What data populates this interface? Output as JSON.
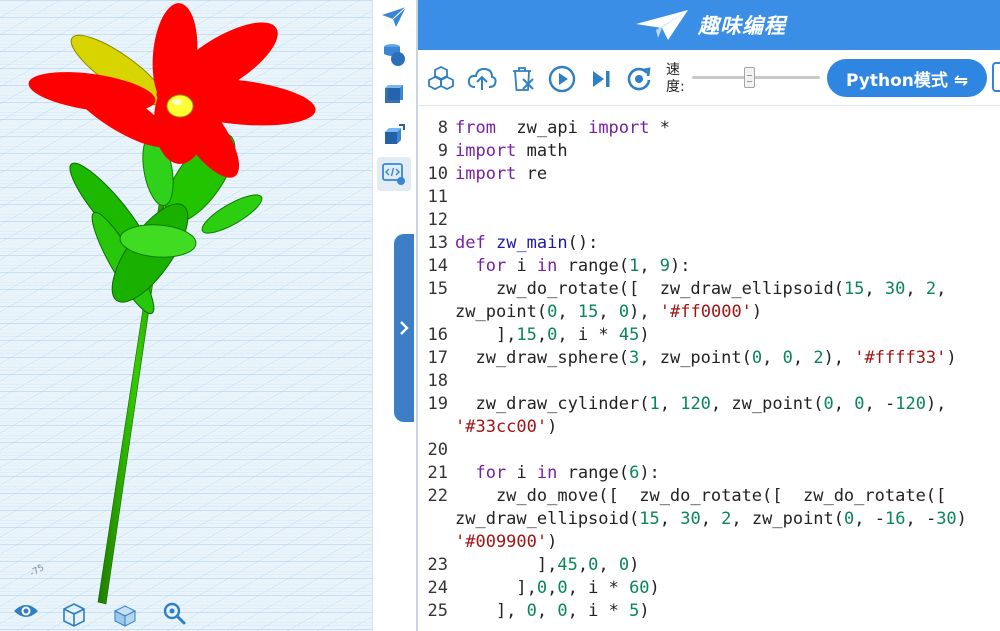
{
  "viewport": {
    "axis_tick": "-75",
    "colors": {
      "background": "#eaf4fb",
      "grid": "#a8cde8",
      "petal": "#ff0000",
      "center": "#ffff33",
      "stem": "#33cc00",
      "leaf": "#009900"
    },
    "bottom_controls": [
      {
        "icon": "eye-icon",
        "name": "view-visibility-button"
      },
      {
        "icon": "wireframe-cube-icon",
        "name": "view-wireframe-button"
      },
      {
        "icon": "solid-cube-icon",
        "name": "view-solid-button"
      },
      {
        "icon": "zoom-icon",
        "name": "view-zoom-button"
      }
    ]
  },
  "toolbox": {
    "items": [
      {
        "icon": "paper-plane-icon"
      },
      {
        "icon": "shapes-icon"
      },
      {
        "icon": "cube-icon"
      },
      {
        "icon": "transform-cube-icon"
      },
      {
        "icon": "code-icon",
        "active": true
      }
    ]
  },
  "header": {
    "title": "趣味编程",
    "logo": "paper-plane-logo"
  },
  "controls": {
    "buttons": [
      {
        "icon": "blocks-icon"
      },
      {
        "icon": "cloud-upload-icon"
      },
      {
        "icon": "clear-trash-icon"
      },
      {
        "icon": "run-icon"
      },
      {
        "icon": "step-icon"
      },
      {
        "icon": "reset-icon"
      }
    ],
    "speed_label": "速度:",
    "speed_value": 0.45,
    "mode_label": "Python模式 ⇋"
  },
  "code": {
    "lines": [
      {
        "n": "8",
        "t": [
          [
            "kw",
            "from"
          ],
          [
            "",
            "  zw_api "
          ],
          [
            "kw",
            "import"
          ],
          [
            "",
            " *"
          ]
        ]
      },
      {
        "n": "9",
        "t": [
          [
            "kw",
            "import"
          ],
          [
            "",
            " math"
          ]
        ]
      },
      {
        "n": "10",
        "t": [
          [
            "kw",
            "import"
          ],
          [
            "",
            " re"
          ]
        ]
      },
      {
        "n": "11",
        "t": []
      },
      {
        "n": "12",
        "t": []
      },
      {
        "n": "13",
        "t": [
          [
            "kw",
            "def"
          ],
          [
            "",
            " "
          ],
          [
            "fn",
            "zw_main"
          ],
          [
            "",
            "():"
          ]
        ]
      },
      {
        "n": "14",
        "t": [
          [
            "",
            "  "
          ],
          [
            "kw",
            "for"
          ],
          [
            "",
            " i "
          ],
          [
            "kw",
            "in"
          ],
          [
            "",
            " range("
          ],
          [
            "nm",
            "1"
          ],
          [
            "",
            ", "
          ],
          [
            "nm",
            "9"
          ],
          [
            "",
            "):"
          ]
        ]
      },
      {
        "n": "15",
        "t": [
          [
            "",
            "    zw_do_rotate([  zw_draw_ellipsoid("
          ],
          [
            "nm",
            "15"
          ],
          [
            "",
            ", "
          ],
          [
            "nm",
            "30"
          ],
          [
            "",
            ", "
          ],
          [
            "nm",
            "2"
          ],
          [
            "",
            ","
          ]
        ]
      },
      {
        "n": "",
        "t": [
          [
            "",
            "zw_point("
          ],
          [
            "nm",
            "0"
          ],
          [
            "",
            ", "
          ],
          [
            "nm",
            "15"
          ],
          [
            "",
            ", "
          ],
          [
            "nm",
            "0"
          ],
          [
            "",
            "), "
          ],
          [
            "st",
            "'#ff0000'"
          ],
          [
            "",
            ")"
          ]
        ]
      },
      {
        "n": "16",
        "t": [
          [
            "",
            "    ],"
          ],
          [
            "nm",
            "15"
          ],
          [
            "",
            ","
          ],
          [
            "nm",
            "0"
          ],
          [
            "",
            ", i * "
          ],
          [
            "nm",
            "45"
          ],
          [
            "",
            ")"
          ]
        ]
      },
      {
        "n": "17",
        "t": [
          [
            "",
            "  zw_draw_sphere("
          ],
          [
            "nm",
            "3"
          ],
          [
            "",
            ", zw_point("
          ],
          [
            "nm",
            "0"
          ],
          [
            "",
            ", "
          ],
          [
            "nm",
            "0"
          ],
          [
            "",
            ", "
          ],
          [
            "nm",
            "2"
          ],
          [
            "",
            "), "
          ],
          [
            "st",
            "'#ffff33'"
          ],
          [
            "",
            ")"
          ]
        ]
      },
      {
        "n": "18",
        "t": []
      },
      {
        "n": "19",
        "t": [
          [
            "",
            "  zw_draw_cylinder("
          ],
          [
            "nm",
            "1"
          ],
          [
            "",
            ", "
          ],
          [
            "nm",
            "120"
          ],
          [
            "",
            ", zw_point("
          ],
          [
            "nm",
            "0"
          ],
          [
            "",
            ", "
          ],
          [
            "nm",
            "0"
          ],
          [
            "",
            ", -"
          ],
          [
            "nm",
            "120"
          ],
          [
            "",
            "),"
          ]
        ]
      },
      {
        "n": "",
        "t": [
          [
            "st",
            "'#33cc00'"
          ],
          [
            "",
            ")"
          ]
        ]
      },
      {
        "n": "20",
        "t": []
      },
      {
        "n": "21",
        "t": [
          [
            "",
            "  "
          ],
          [
            "kw",
            "for"
          ],
          [
            "",
            " i "
          ],
          [
            "kw",
            "in"
          ],
          [
            "",
            " range("
          ],
          [
            "nm",
            "6"
          ],
          [
            "",
            "):"
          ]
        ]
      },
      {
        "n": "22",
        "t": [
          [
            "",
            "    zw_do_move([  zw_do_rotate([  zw_do_rotate(["
          ]
        ]
      },
      {
        "n": "",
        "t": [
          [
            "",
            "zw_draw_ellipsoid("
          ],
          [
            "nm",
            "15"
          ],
          [
            "",
            ", "
          ],
          [
            "nm",
            "30"
          ],
          [
            "",
            ", "
          ],
          [
            "nm",
            "2"
          ],
          [
            "",
            ", zw_point("
          ],
          [
            "nm",
            "0"
          ],
          [
            "",
            ", -"
          ],
          [
            "nm",
            "16"
          ],
          [
            "",
            ", -"
          ],
          [
            "nm",
            "30"
          ],
          [
            "",
            ")"
          ]
        ]
      },
      {
        "n": "",
        "t": [
          [
            "st",
            "'#009900'"
          ],
          [
            "",
            ")"
          ]
        ]
      },
      {
        "n": "23",
        "t": [
          [
            "",
            "        ],"
          ],
          [
            "nm",
            "45"
          ],
          [
            "",
            ","
          ],
          [
            "nm",
            "0"
          ],
          [
            "",
            ", "
          ],
          [
            "nm",
            "0"
          ],
          [
            "",
            ")"
          ]
        ]
      },
      {
        "n": "24",
        "t": [
          [
            "",
            "      ],"
          ],
          [
            "nm",
            "0"
          ],
          [
            "",
            ","
          ],
          [
            "nm",
            "0"
          ],
          [
            "",
            ", i * "
          ],
          [
            "nm",
            "60"
          ],
          [
            "",
            ")"
          ]
        ]
      },
      {
        "n": "25",
        "t": [
          [
            "",
            "    ], "
          ],
          [
            "nm",
            "0"
          ],
          [
            "",
            ", "
          ],
          [
            "nm",
            "0"
          ],
          [
            "",
            ", i * "
          ],
          [
            "nm",
            "5"
          ],
          [
            "",
            ")"
          ]
        ]
      }
    ]
  }
}
